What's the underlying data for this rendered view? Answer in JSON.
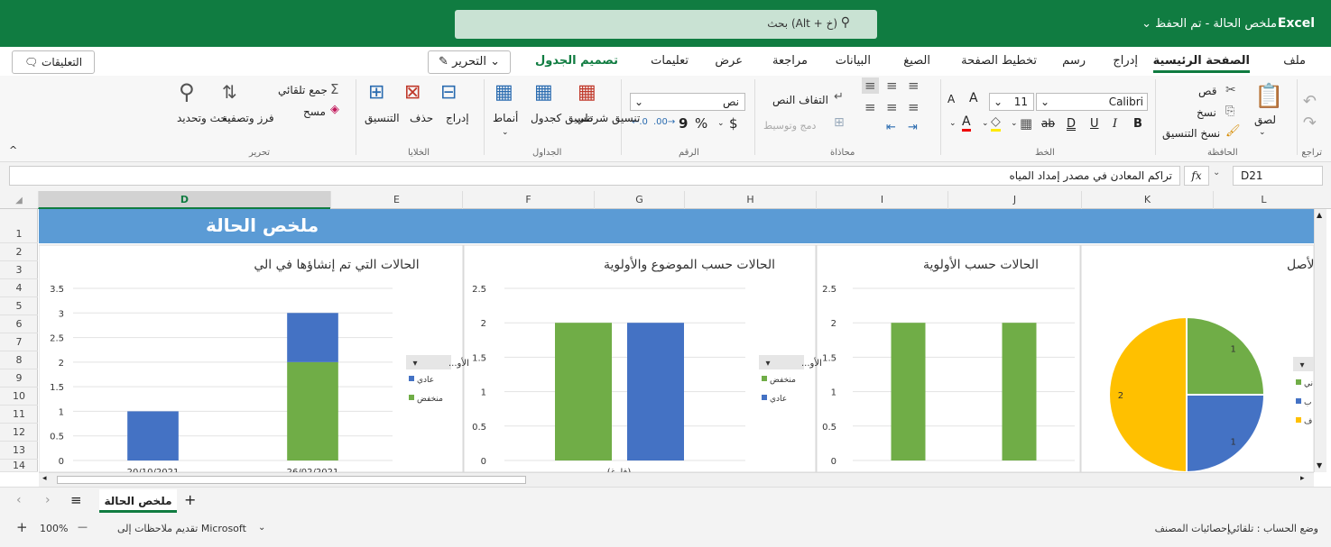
{
  "titlebar": {
    "app": "Excel",
    "doc_title": "ملخص الحالة - تم الحفظ ⌄",
    "search_placeholder": "بحث (Alt + خ)"
  },
  "tabs": [
    {
      "label": "ملف"
    },
    {
      "label": "الصفحة الرئيسية"
    },
    {
      "label": "إدراج"
    },
    {
      "label": "رسم"
    },
    {
      "label": "تخطيط الصفحة"
    },
    {
      "label": "الصيغ"
    },
    {
      "label": "البيانات"
    },
    {
      "label": "مراجعة"
    },
    {
      "label": "عرض"
    },
    {
      "label": "تعليمات"
    },
    {
      "label": "تصميم الجدول"
    }
  ],
  "edit_button": "التحرير ⌄",
  "comments_button": "التعليقات",
  "ribbon": {
    "undo_group": "تراجع",
    "clipboard": {
      "paste": "لصق",
      "cut": "قص",
      "copy": "نسخ",
      "format_painter": "نسخ التنسيق",
      "group": "الحافظة"
    },
    "font": {
      "name": "Calibri",
      "size": "11",
      "bold": "B",
      "italic": "I",
      "underline": "U",
      "double_underline": "D",
      "strike": "ab",
      "grow": "A",
      "shrink": "A",
      "group": "الخط"
    },
    "alignment": {
      "wrap": "التفاف النص",
      "merge": "دمج وتوسيط",
      "group": "محاذاة"
    },
    "number": {
      "format": "نص",
      "currency": "$",
      "percent": "%",
      "comma": "9",
      "group": "الرقم"
    },
    "tables": {
      "conditional": "تنسيق شرطي",
      "as_table": "تنسيق كجدول",
      "styles": "أنماط",
      "group": "الجداول"
    },
    "cells": {
      "insert": "إدراج",
      "delete": "حذف",
      "format": "التنسيق",
      "group": "الخلايا"
    },
    "editing": {
      "autosum": "جمع تلقائي",
      "clear": "مسح",
      "sort": "فرز وتصفية",
      "find": "بحث وتحديد",
      "group": "تحرير"
    }
  },
  "formula_bar": {
    "name_box": "D21",
    "fx": "fx",
    "formula": "تراكم المعادن في مصدر إمداد المياه"
  },
  "columns": [
    {
      "label": "D",
      "selected": true
    },
    {
      "label": "E"
    },
    {
      "label": "F"
    },
    {
      "label": "G"
    },
    {
      "label": "H"
    },
    {
      "label": "I"
    },
    {
      "label": "J"
    },
    {
      "label": "K"
    },
    {
      "label": "L"
    }
  ],
  "rows": [
    "1",
    "2",
    "3",
    "4",
    "5",
    "6",
    "7",
    "8",
    "9",
    "10",
    "11",
    "12",
    "13",
    "14"
  ],
  "banner_title": "ملخص الحالة",
  "colors": {
    "blue": "#4472c4",
    "green": "#70ad47",
    "gold": "#ffc000",
    "excel_green": "#107c41",
    "banner": "#5b9bd5"
  },
  "chart_data": [
    {
      "type": "bar",
      "title": "الحالات التي تم إنشاؤها في الي",
      "categories": [
        "20/10/2021",
        "26/02/2021"
      ],
      "series": [
        {
          "name": "منخفض",
          "color": "#70ad47",
          "values": [
            0,
            2
          ]
        },
        {
          "name": "عادي",
          "color": "#4472c4",
          "values": [
            1,
            1
          ]
        }
      ],
      "stacked": true,
      "ylim": [
        0,
        3.5
      ],
      "yticks": [
        "0",
        "0.5",
        "1",
        "1.5",
        "2",
        "2.5",
        "3",
        "3.5"
      ],
      "legend_header": "الأو..."
    },
    {
      "type": "bar",
      "title": "الحالات حسب الموضوع والأولوية",
      "categories": [
        "(فارغ)"
      ],
      "series": [
        {
          "name": "منخفض",
          "color": "#70ad47",
          "values": [
            2
          ]
        },
        {
          "name": "عادي",
          "color": "#4472c4",
          "values": [
            2
          ]
        }
      ],
      "ylim": [
        0,
        2.5
      ],
      "yticks": [
        "0",
        "0.5",
        "1",
        "1.5",
        "2",
        "2.5"
      ],
      "legend_header": "الأو..."
    },
    {
      "type": "bar",
      "title": "الحالات حسب الأولوية",
      "categories": [
        "",
        ""
      ],
      "series": [
        {
          "color": "#70ad47",
          "values": [
            2,
            2
          ]
        }
      ],
      "ylim": [
        0,
        2.5
      ],
      "yticks": [
        "0",
        "0.5",
        "1",
        "1.5",
        "2",
        "2.5"
      ]
    },
    {
      "type": "pie",
      "title": "مزيج من الحالات حسب الأصل",
      "slices": [
        {
          "color": "#70ad47",
          "value": 1,
          "label": "1",
          "legend": "ني"
        },
        {
          "color": "#4472c4",
          "value": 1,
          "label": "1",
          "legend": "ب"
        },
        {
          "color": "#ffc000",
          "value": 2,
          "label": "2",
          "legend": "ف"
        }
      ]
    }
  ],
  "sheet_tab": "ملخص الحالة",
  "status": {
    "calc_mode": "وضع الحساب : تلقائي",
    "stats": "إحصائيات المصنف",
    "feedback": "تقديم ملاحظات إلى Microsoft",
    "zoom": "100%",
    "minus": "—",
    "plus": "+"
  }
}
